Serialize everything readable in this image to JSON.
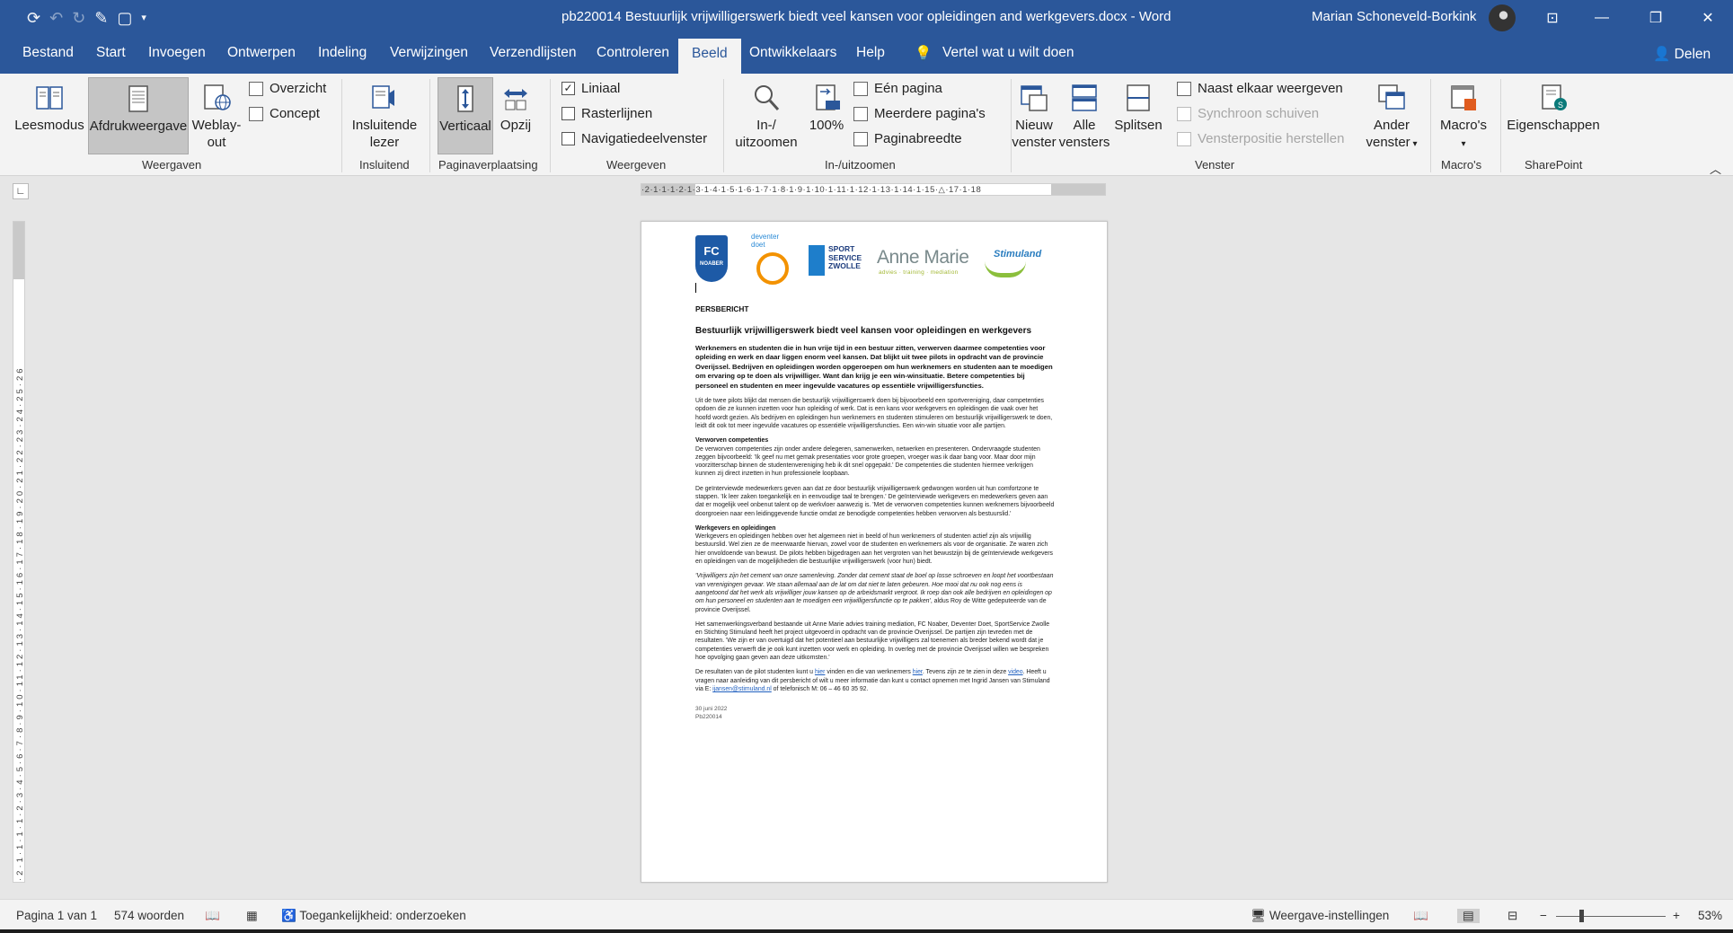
{
  "window": {
    "title": "pb220014 Bestuurlijk vrijwilligerswerk biedt veel kansen voor opleidingen and werkgevers.docx - Word",
    "user": "Marian Schoneveld-Borkink"
  },
  "tabs": [
    "Bestand",
    "Start",
    "Invoegen",
    "Ontwerpen",
    "Indeling",
    "Verwijzingen",
    "Verzendlijsten",
    "Controleren",
    "Beeld",
    "Ontwikkelaars",
    "Help",
    "Vertel wat u wilt doen"
  ],
  "share_label": "Delen",
  "ribbon": {
    "weergaven": {
      "label": "Weergaven",
      "leesmodus": "Leesmodus",
      "afdrukweergave": "Afdrukweergave",
      "weblayout1": "Weblay-",
      "weblayout2": "out",
      "overzicht": "Overzicht",
      "concept": "Concept"
    },
    "insluitend": {
      "label": "Insluitend",
      "lezer1": "Insluitende",
      "lezer2": "lezer"
    },
    "paginaverplaatsing": {
      "label": "Paginaverplaatsing",
      "verticaal": "Verticaal",
      "opzij": "Opzij"
    },
    "weergeven": {
      "label": "Weergeven",
      "liniaal": "Liniaal",
      "rasterlijnen": "Rasterlijnen",
      "navigatie": "Navigatiedeelvenster",
      "liniaal_checked": true,
      "rasterlijnen_checked": false,
      "navigatie_checked": false
    },
    "zoom": {
      "label": "In-/uitzoomen",
      "inuit1": "In-/",
      "inuit2": "uitzoomen",
      "honderd": "100%",
      "een_pagina": "Eén pagina",
      "meerdere": "Meerdere pagina's",
      "paginabreedte": "Paginabreedte"
    },
    "venster": {
      "label": "Venster",
      "nieuw1": "Nieuw",
      "nieuw2": "venster",
      "alle1": "Alle",
      "alle2": "vensters",
      "splitsen": "Splitsen",
      "naast": "Naast elkaar weergeven",
      "synchroon": "Synchroon schuiven",
      "positie": "Vensterpositie herstellen",
      "ander1": "Ander",
      "ander2": "venster"
    },
    "macros": {
      "label": "Macro's",
      "btn": "Macro's"
    },
    "sharepoint": {
      "label": "SharePoint",
      "btn": "Eigenschappen"
    }
  },
  "ruler": {
    "horizontal": "·2·1·1·1·2·1·3·1·4·1·5·1·6·1·7·1·8·1·9·1·10·1·11·1·12·1·13·1·14·1·15·△·17·1·18",
    "vertical": "·2·1·1·1·1·2·3·4·5·6·7·8·9·10·11·12·13·14·15·16·17·18·19·20·21·22·23·24·25·26"
  },
  "logos": {
    "fc1": "FC",
    "fc2": "NOABER",
    "deventer": "deventer doet",
    "sport1": "SPORT",
    "sport2": "SERVICE",
    "sport3": "ZWOLLE",
    "annemarie": "Anne Marie",
    "annemarie_sub": "advies · training · mediation",
    "stimuland": "Stimuland"
  },
  "document": {
    "label": "PERSBERICHT",
    "title": "Bestuurlijk vrijwilligerswerk biedt veel kansen voor opleidingen en werkgevers",
    "lead": "Werknemers en studenten die in hun vrije tijd in een bestuur zitten, verwerven daarmee competenties voor opleiding en werk en daar liggen enorm veel kansen. Dat blijkt uit twee pilots in opdracht van de provincie Overijssel. Bedrijven en opleidingen worden opgeroepen om hun werknemers en studenten aan te moedigen om ervaring op te doen als vrijwilliger. Want dan krijg je een win-winsituatie. Betere competenties bij personeel en studenten en meer ingevulde vacatures op essentiële vrijwilligersfuncties.",
    "p1": "Uit de twee pilots blijkt dat mensen die bestuurlijk vrijwilligerswerk doen bij bijvoorbeeld een sportvereniging, daar competenties opdoen die ze kunnen inzetten voor hun opleiding of werk. Dat is een kans voor werkgevers en opleidingen die vaak over het hoofd wordt gezien. Als bedrijven en opleidingen hun werknemers en studenten stimuleren om bestuurlijk vrijwilligerswerk te doen, leidt dit ook tot meer ingevulde vacatures op essentiële vrijwilligersfuncties. Een win-win situatie voor alle partijen.",
    "h1": "Verworven competenties",
    "p2": "De verworven competenties zijn onder andere delegeren, samenwerken, netwerken en presenteren. Ondervraagde studenten zeggen bijvoorbeeld: 'Ik geef nu met gemak presentaties voor grote groepen, vroeger was ik daar bang voor. Maar door mijn voorzitterschap binnen de studentenvereniging heb ik dit snel opgepakt.' De competenties die studenten hiermee verkrijgen kunnen zij direct inzetten in hun professionele loopbaan.",
    "p3": "De geïnterviewde medewerkers geven aan dat ze door bestuurlijk vrijwilligerswerk gedwongen worden uit hun comfortzone te stappen. 'Ik leer zaken toegankelijk en in eenvoudige taal te brengen.' De geïnterviewde werkgevers en medewerkers geven aan dat er mogelijk veel onbenut talent op de werkvloer aanwezig is. 'Met de verworven competenties kunnen werknemers bijvoorbeeld doorgroeien naar een leidinggevende functie omdat ze benodigde competenties hebben verworven als bestuurslid.'",
    "h2": "Werkgevers en opleidingen",
    "p4": "Werkgevers en opleidingen hebben over het algemeen niet in beeld of hun werknemers of studenten actief zijn als vrijwillig bestuurslid. Wel zien ze de meerwaarde hiervan, zowel voor de studenten en werknemers als voor de organisatie. Ze waren zich hier onvoldoende van bewust. De pilots hebben bijgedragen aan het vergroten van het bewustzijn bij de geïnterviewde werkgevers en opleidingen van de mogelijkheden die bestuurlijke vrijwilligerswerk (voor hun) biedt.",
    "quote": "'Vrijwilligers zijn het cement van onze samenleving. Zonder dat cement staat de boel op losse schroeven en loopt het voortbestaan van verenigingen gevaar. We staan allemaal aan de lat om dat niet te laten gebeuren. Hoe mooi dat nu ook nog eens is aangetoond dat het werk als vrijwilliger jouw kansen op de arbeidsmarkt vergroot. Ik roep dan ook alle bedrijven en opleidingen op om hun personeel en studenten aan te moedigen een vrijwilligersfunctie op te pakken'",
    "quote_attr": ", aldus Roy de Witte gedeputeerde van de provincie Overijssel.",
    "p5": "Het samenwerkingsverband bestaande uit Anne Marie advies training mediation, FC Noaber, Deventer Doet, SportService Zwolle en Stichting Stimuland heeft het project uitgevoerd in opdracht van de provincie Overijssel. De partijen zijn tevreden met de resultaten. 'We zijn er van overtuigd dat het potentieel aan bestuurlijke vrijwilligers zal toenemen als breder bekend wordt dat je competenties verwerft die je ook kunt inzetten voor werk en opleiding. In overleg met de provincie Overijssel willen we bespreken hoe opvolging gaan geven aan deze uitkomsten.'",
    "p6_a": "De resultaten van de pilot studenten kunt u ",
    "link_hier1": "hier",
    "p6_b": " vinden en die van werknemers ",
    "link_hier2": "hier",
    "p6_c": ". Tevens zijn ze te zien in deze ",
    "link_video": "video",
    "p6_d": ". Heeft u vragen naar aanleiding van dit persbericht of wilt u meer informatie dan kunt u contact opnemen met Ingrid Jansen van Stimuland via E: ",
    "link_email": "ijansen@stimuland.nl",
    "p6_e": " of telefonisch M: 06 – 46 60 35 92.",
    "date": "30 juni 2022",
    "ref": "Pb220014"
  },
  "status": {
    "page": "Pagina 1 van 1",
    "words": "574 woorden",
    "accessibility": "Toegankelijkheid: onderzoeken",
    "view_settings": "Weergave-instellingen",
    "zoom_level": "53%",
    "minus": "−",
    "plus": "+"
  }
}
